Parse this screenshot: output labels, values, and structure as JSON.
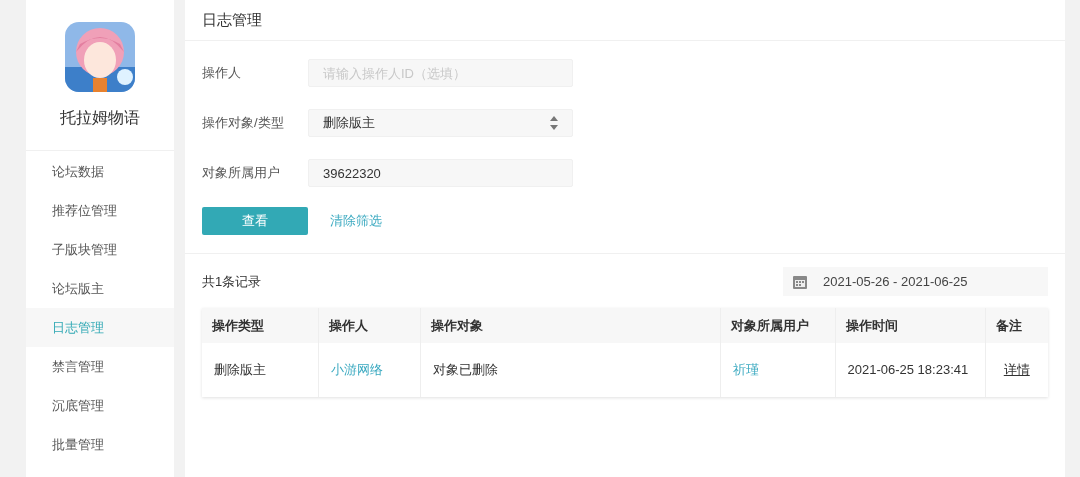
{
  "sidebar": {
    "app_name": "托拉姆物语",
    "items": [
      {
        "label": "论坛数据",
        "selected": false
      },
      {
        "label": "推荐位管理",
        "selected": false
      },
      {
        "label": "子版块管理",
        "selected": false
      },
      {
        "label": "论坛版主",
        "selected": false
      },
      {
        "label": "日志管理",
        "selected": true
      },
      {
        "label": "禁言管理",
        "selected": false
      },
      {
        "label": "沉底管理",
        "selected": false
      },
      {
        "label": "批量管理",
        "selected": false
      }
    ]
  },
  "page_title": "日志管理",
  "filters": [
    {
      "kind": "input",
      "label": "操作人",
      "placeholder": "请输入操作人ID（选填）"
    },
    {
      "kind": "select",
      "label": "操作对象/类型",
      "value": "删除版主"
    },
    {
      "kind": "input",
      "label": "对象所属用户",
      "value": "39622320"
    }
  ],
  "search_button": "查看",
  "clear_link": "清除筛选",
  "record_count": "共1条记录",
  "date_range": "2021-05-26 - 2021-06-25",
  "table": {
    "columns": [
      "操作类型",
      "操作人",
      "操作对象",
      "对象所属用户",
      "操作时间",
      "备注"
    ],
    "rows": [
      [
        {
          "kind": "text",
          "text": "删除版主"
        },
        {
          "kind": "link",
          "text": "小游网络"
        },
        {
          "kind": "text",
          "text": "对象已删除"
        },
        {
          "kind": "link",
          "text": "祈瑾"
        },
        {
          "kind": "text",
          "text": "2021-06-25 18:23:41"
        },
        {
          "kind": "action",
          "text": "详情"
        }
      ]
    ]
  }
}
